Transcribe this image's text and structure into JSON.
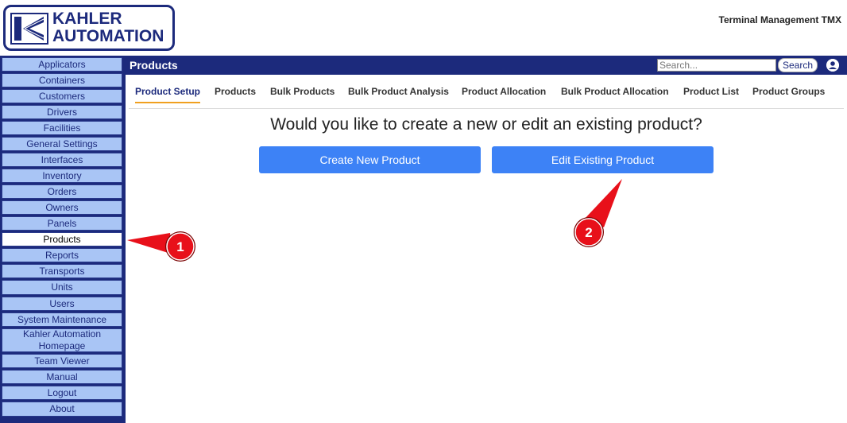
{
  "header": {
    "logo_line1": "KAHLER",
    "logo_line2": "AUTOMATION",
    "app_title": "Terminal Management TMX"
  },
  "sidebar": {
    "items": [
      {
        "label": "Applicators",
        "active": false
      },
      {
        "label": "Containers",
        "active": false
      },
      {
        "label": "Customers",
        "active": false
      },
      {
        "label": "Drivers",
        "active": false
      },
      {
        "label": "Facilities",
        "active": false
      },
      {
        "label": "General Settings",
        "active": false
      },
      {
        "label": "Interfaces",
        "active": false
      },
      {
        "label": "Inventory",
        "active": false
      },
      {
        "label": "Orders",
        "active": false
      },
      {
        "label": "Owners",
        "active": false
      },
      {
        "label": "Panels",
        "active": false
      },
      {
        "label": "Products",
        "active": true
      },
      {
        "label": "Reports",
        "active": false
      },
      {
        "label": "Transports",
        "active": false
      },
      {
        "label": "Units",
        "active": false
      },
      {
        "label": "Users",
        "active": false
      },
      {
        "label": "System Maintenance",
        "active": false
      },
      {
        "label": "Kahler Automation Homepage",
        "active": false
      },
      {
        "label": "Team Viewer",
        "active": false
      },
      {
        "label": "Manual",
        "active": false
      },
      {
        "label": "Logout",
        "active": false
      },
      {
        "label": "About",
        "active": false
      }
    ]
  },
  "topbar": {
    "title": "Products",
    "search_placeholder": "Search...",
    "search_button": "Search"
  },
  "tabs": [
    {
      "label": "Product Setup",
      "active": true
    },
    {
      "label": "Products",
      "active": false
    },
    {
      "label": "Bulk Products",
      "active": false
    },
    {
      "label": "Bulk Product Analysis",
      "active": false
    },
    {
      "label": "Product Allocation",
      "active": false
    },
    {
      "label": "Bulk Product Allocation",
      "active": false
    },
    {
      "label": "Product List",
      "active": false
    },
    {
      "label": "Product Groups",
      "active": false
    }
  ],
  "main": {
    "question": "Would you like to create a new or edit an existing product?",
    "create_button": "Create New Product",
    "edit_button": "Edit Existing Product"
  },
  "annotations": [
    {
      "number": "1"
    },
    {
      "number": "2"
    }
  ],
  "colors": {
    "brand_navy": "#1c2a7c",
    "sidebar_item": "#a9c5f5",
    "button_blue": "#3d82f6",
    "tab_accent": "#f0a020",
    "annotation_red": "#e8101a"
  }
}
